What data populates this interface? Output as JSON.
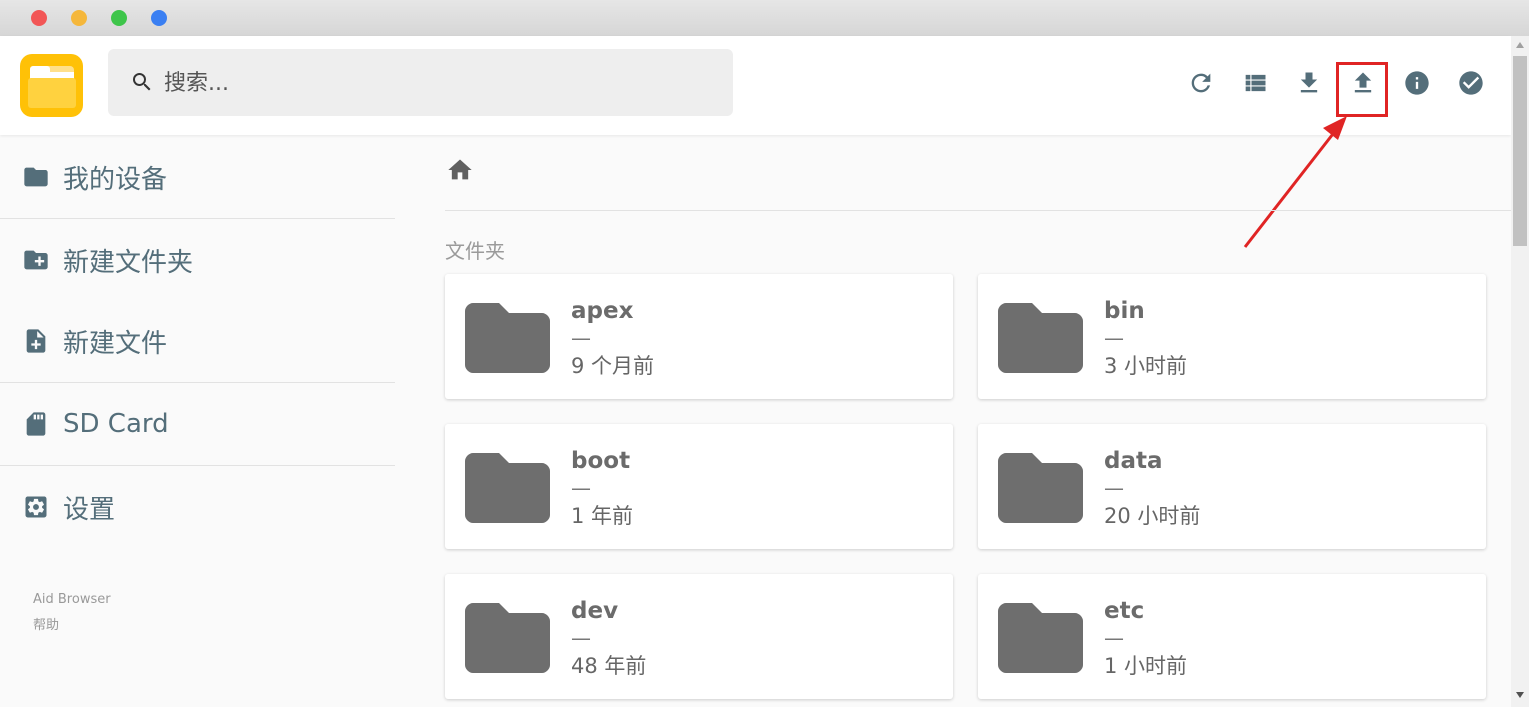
{
  "window": {
    "buttons": [
      "close",
      "minimize",
      "maximize",
      "extra"
    ]
  },
  "header": {
    "search": {
      "placeholder": "搜索..."
    },
    "toolbar": [
      {
        "name": "refresh-icon"
      },
      {
        "name": "list-view-icon"
      },
      {
        "name": "download-icon"
      },
      {
        "name": "upload-icon",
        "highlighted": true
      },
      {
        "name": "info-icon"
      },
      {
        "name": "select-all-icon"
      }
    ]
  },
  "sidebar": {
    "items": [
      {
        "label": "我的设备",
        "icon": "folder-icon"
      },
      {
        "label": "新建文件夹",
        "icon": "new-folder-icon"
      },
      {
        "label": "新建文件",
        "icon": "new-file-icon"
      },
      {
        "label": "SD Card",
        "icon": "sd-card-icon"
      },
      {
        "label": "设置",
        "icon": "settings-icon"
      }
    ],
    "footer": {
      "app_name": "Aid Browser",
      "help": "帮助"
    }
  },
  "main": {
    "breadcrumb_icon": "home-icon",
    "section_title": "文件夹",
    "folders": [
      {
        "name": "apex",
        "size": "—",
        "modified": "9 个月前"
      },
      {
        "name": "bin",
        "size": "—",
        "modified": "3 小时前"
      },
      {
        "name": "boot",
        "size": "—",
        "modified": "1 年前"
      },
      {
        "name": "data",
        "size": "—",
        "modified": "20 小时前"
      },
      {
        "name": "dev",
        "size": "—",
        "modified": "48 年前"
      },
      {
        "name": "etc",
        "size": "—",
        "modified": "1 小时前"
      }
    ]
  },
  "colors": {
    "accent": "#546e7a",
    "logo": "#ffc107",
    "highlight": "#e02424",
    "folder": "#6e6e6e"
  }
}
